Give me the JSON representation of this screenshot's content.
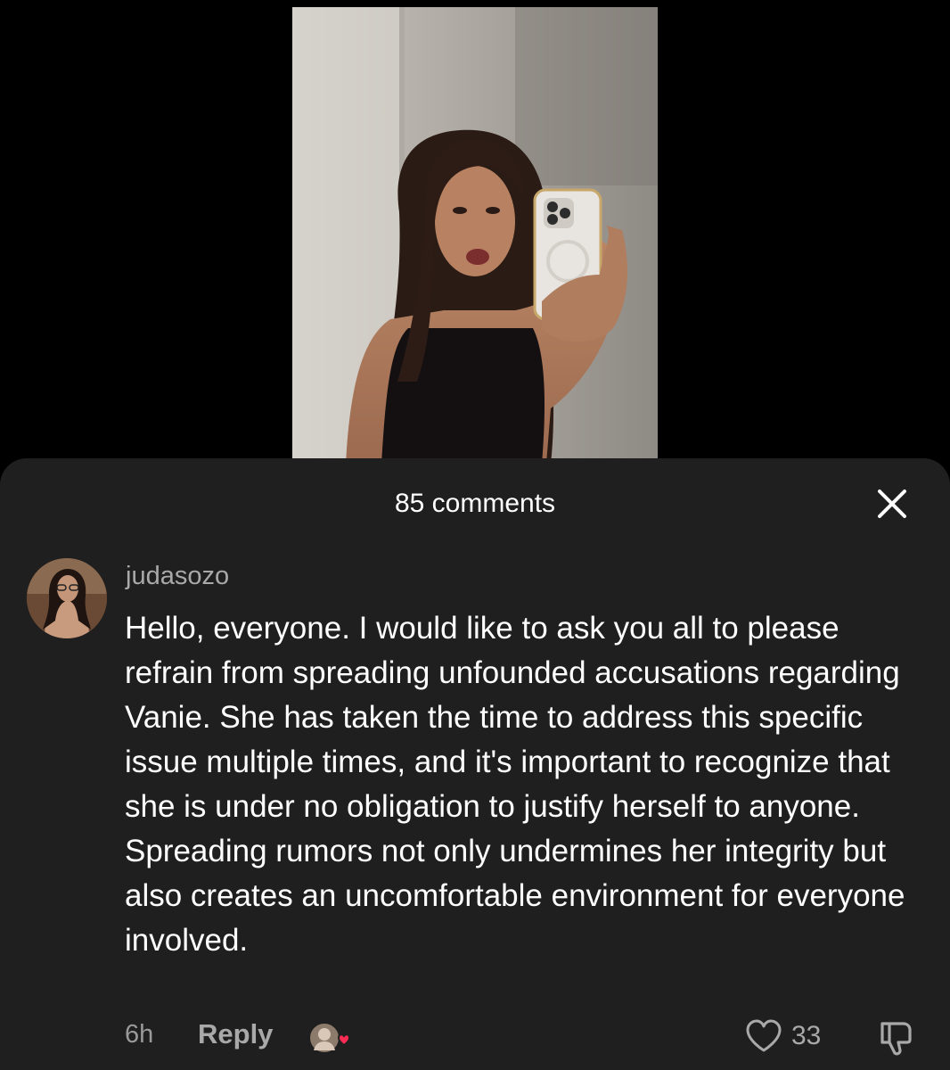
{
  "video": {
    "alt": "mirror selfie photo"
  },
  "sheet": {
    "comments_count_label": "85 comments",
    "close_icon": "close-icon"
  },
  "comment": {
    "username": "judasozo",
    "text": "Hello, everyone. I would like to ask you all to please refrain from spreading unfounded accusations regarding Vanie. She has taken the time to address this specific issue multiple times, and it's important to recognize that she is under no obligation to justify herself to anyone. Spreading rumors not only undermines her integrity but also creates an uncomfortable environment for everyone involved.",
    "time": "6h",
    "reply_label": "Reply",
    "like_count": "33",
    "creator_liked": true,
    "icons": {
      "like": "heart-outline-icon",
      "dislike": "thumbs-down-icon",
      "creator_liked": "creator-liked-badge-icon"
    }
  },
  "colors": {
    "background": "#000000",
    "sheet": "#1f1f1f",
    "text_primary": "#ffffff",
    "text_secondary": "#a9a9a9",
    "heart_badge": "#fe2c55"
  }
}
